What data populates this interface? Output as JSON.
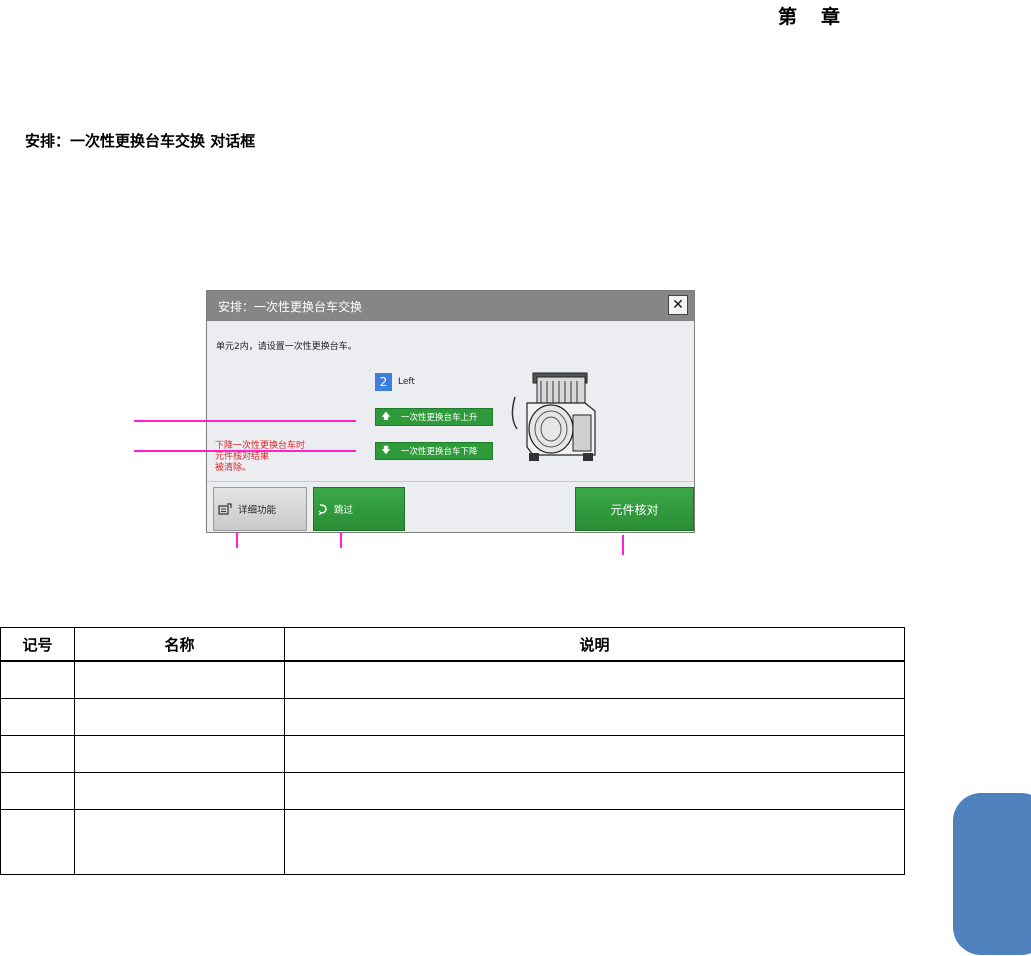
{
  "header": {
    "chapter_left": "第",
    "chapter_right": "章"
  },
  "section_title": "安排：一次性更换台车交换 对话框",
  "dialog": {
    "title": "安排：一次性更换台车交换",
    "close_label": "✕",
    "message": "单元2内，请设置一次性更换台车。",
    "unit_number": "2",
    "unit_side": "Left",
    "raise_button": "一次性更换台车上升",
    "lower_button": "一次性更换台车下降",
    "warning_lines": [
      "下降一次性更换台车时",
      "元件核对结果",
      "被清除。"
    ],
    "detail_button": "详细功能",
    "skip_button": "跳过",
    "verify_button": "元件核对",
    "icons": {
      "up": "arrow-up-icon",
      "down": "arrow-down-icon",
      "detail": "detail-settings-icon",
      "skip": "skip-icon"
    }
  },
  "table": {
    "headers": [
      "记号",
      "名称",
      "说明"
    ],
    "rows": [
      [
        "",
        "",
        ""
      ],
      [
        "",
        "",
        ""
      ],
      [
        "",
        "",
        ""
      ],
      [
        "",
        "",
        ""
      ],
      [
        "",
        "",
        ""
      ]
    ]
  },
  "colors": {
    "accent_green": "#2f9a3a",
    "callout_magenta": "#ff1fd0",
    "tab_blue": "#4f81bd",
    "warning_red": "#e0242a"
  }
}
